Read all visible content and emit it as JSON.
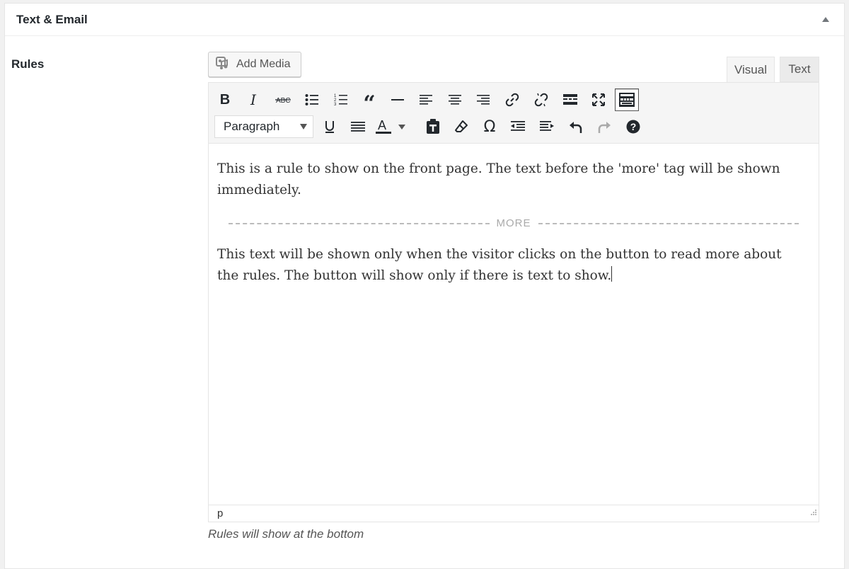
{
  "postbox": {
    "title": "Text & Email"
  },
  "field": {
    "label": "Rules",
    "help": "Rules will show at the bottom"
  },
  "editor": {
    "add_media": "Add Media",
    "tabs": {
      "visual": "Visual",
      "text": "Text"
    },
    "format": "Paragraph",
    "paragraph1": "This is a rule to show on the front page. The text before the 'more' tag will be shown immediately.",
    "more_label": "MORE",
    "paragraph2": "This text will be shown only when the visitor clicks on the button to read more about the rules. The button will show only if there is text to show.",
    "path": "p"
  },
  "icons": [
    "bold-icon",
    "italic-icon",
    "strikethrough-icon",
    "bullet-list-icon",
    "numbered-list-icon",
    "blockquote-icon",
    "horizontal-line-icon",
    "align-left-icon",
    "align-center-icon",
    "align-right-icon",
    "link-icon",
    "unlink-icon",
    "read-more-icon",
    "fullscreen-icon",
    "toolbar-toggle-icon",
    "underline-icon",
    "justify-icon",
    "text-color-icon",
    "paste-text-icon",
    "clear-formatting-icon",
    "special-character-icon",
    "outdent-icon",
    "indent-icon",
    "undo-icon",
    "redo-icon",
    "help-icon"
  ],
  "colors": {
    "accent": "#555555",
    "toolbar_bg": "#f5f5f5",
    "page_bg": "#f1f1f1"
  }
}
